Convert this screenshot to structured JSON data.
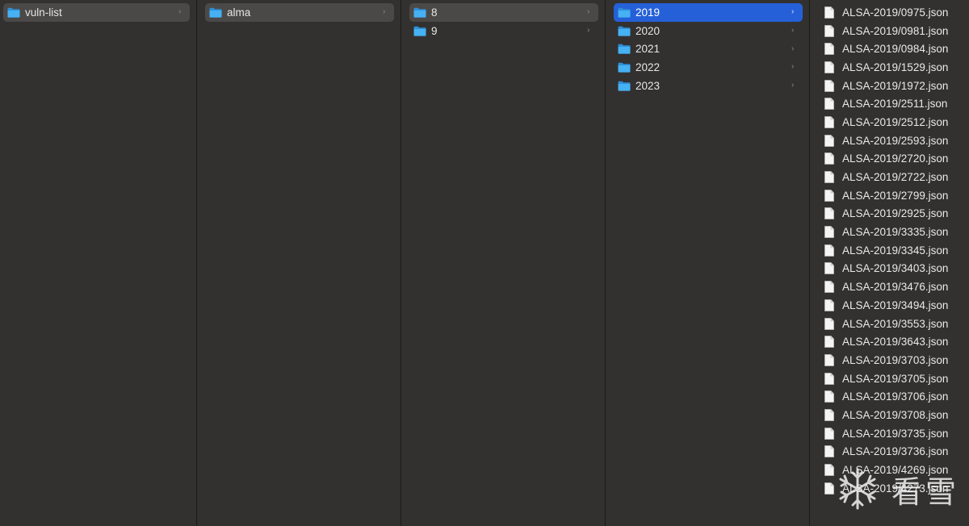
{
  "columns": [
    {
      "items": [
        {
          "name": "vuln-list",
          "state": "inactive"
        }
      ]
    },
    {
      "items": [
        {
          "name": "alma",
          "state": "inactive"
        }
      ]
    },
    {
      "items": [
        {
          "name": "8",
          "state": "inactive"
        },
        {
          "name": "9",
          "state": "none"
        }
      ]
    },
    {
      "items": [
        {
          "name": "2019",
          "state": "active"
        },
        {
          "name": "2020",
          "state": "none"
        },
        {
          "name": "2021",
          "state": "none"
        },
        {
          "name": "2022",
          "state": "none"
        },
        {
          "name": "2023",
          "state": "none"
        }
      ]
    }
  ],
  "files": [
    "ALSA-2019/0975.json",
    "ALSA-2019/0981.json",
    "ALSA-2019/0984.json",
    "ALSA-2019/1529.json",
    "ALSA-2019/1972.json",
    "ALSA-2019/2511.json",
    "ALSA-2019/2512.json",
    "ALSA-2019/2593.json",
    "ALSA-2019/2720.json",
    "ALSA-2019/2722.json",
    "ALSA-2019/2799.json",
    "ALSA-2019/2925.json",
    "ALSA-2019/3335.json",
    "ALSA-2019/3345.json",
    "ALSA-2019/3403.json",
    "ALSA-2019/3476.json",
    "ALSA-2019/3494.json",
    "ALSA-2019/3553.json",
    "ALSA-2019/3643.json",
    "ALSA-2019/3703.json",
    "ALSA-2019/3705.json",
    "ALSA-2019/3706.json",
    "ALSA-2019/3708.json",
    "ALSA-2019/3735.json",
    "ALSA-2019/3736.json",
    "ALSA-2019/4269.json",
    "ALSA-2019/4273.json"
  ],
  "icons": {
    "folder": "folder-icon",
    "file": "document-icon",
    "chevron": "chevron-right-icon"
  },
  "colors": {
    "selection_active": "#2560d8",
    "selection_inactive": "#4a4948",
    "folder": "#3aa5ee"
  },
  "watermark": {
    "text": "看雪"
  }
}
